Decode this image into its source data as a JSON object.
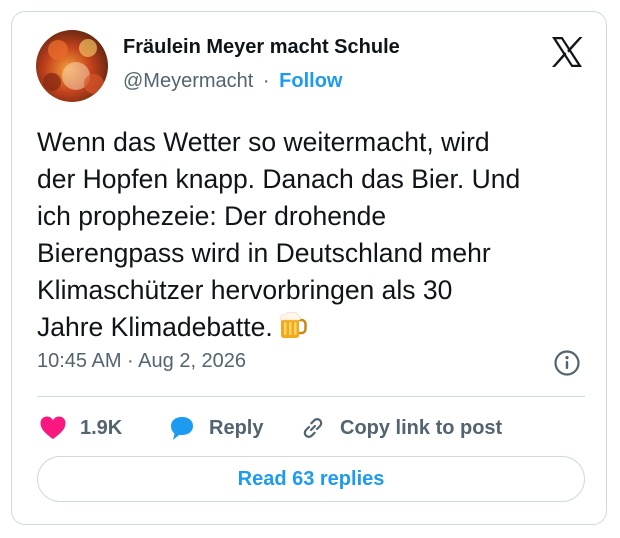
{
  "author": {
    "name": "Fräulein Meyer macht Schule",
    "handle": "@Meyermacht",
    "separator": "·",
    "follow_label": "Follow"
  },
  "tweet": {
    "text": "Wenn das Wetter so weitermacht, wird\nder Hopfen knapp. Danach das Bier. Und\nich prophezeie: Der drohende\nBierengpass wird in Deutschland mehr\nKlimaschützer hervorbringen als 30\nJahre Klimadebatte.",
    "emoji": "beer-mug-icon",
    "timestamp": "10:45 AM · Aug 2, 2026"
  },
  "actions": {
    "likes_count": "1.9K",
    "reply_label": "Reply",
    "copy_link_label": "Copy link to post"
  },
  "read_replies_label": "Read 63 replies",
  "icons": [
    "x-logo-icon",
    "info-icon",
    "heart-icon",
    "reply-bubble-icon",
    "link-icon",
    "beer-mug-icon"
  ],
  "colors": {
    "accent": "#1d9bf0",
    "like": "#f91880",
    "text": "#0f1419",
    "muted": "#536471",
    "border": "#cfd9de"
  }
}
